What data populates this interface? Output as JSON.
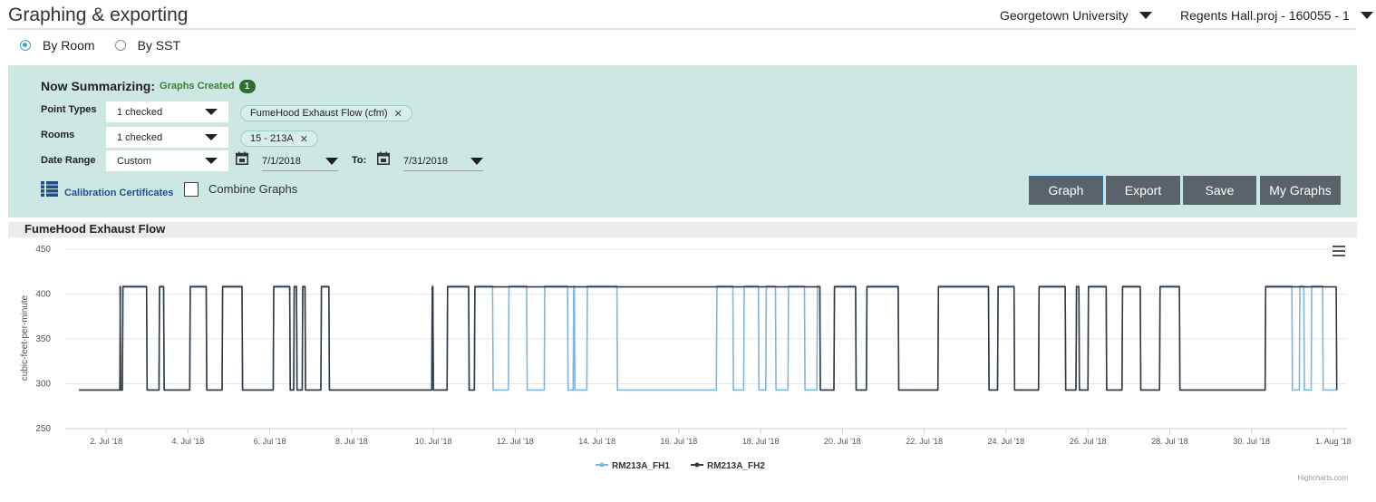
{
  "page_title": "Graphing & exporting",
  "top": {
    "org": "Georgetown University",
    "project": "Regents Hall.proj - 160055 - 1"
  },
  "radios": [
    {
      "label": "By Room",
      "selected": true
    },
    {
      "label": "By SST",
      "selected": false
    }
  ],
  "summary": {
    "heading": "Now Summarizing:",
    "graphs_created_label": "Graphs Created",
    "graphs_created_count": "1",
    "point_types": {
      "label": "Point Types",
      "value": "1 checked",
      "tag": "FumeHood Exhaust Flow (cfm)"
    },
    "rooms": {
      "label": "Rooms",
      "value": "1 checked",
      "tag": "15 - 213A"
    },
    "date_range": {
      "label": "Date Range",
      "value": "Custom",
      "from": "7/1/2018",
      "to_label": "To:",
      "to": "7/31/2018"
    },
    "calibration_link": "Calibration Certificates",
    "combine_label": "Combine Graphs",
    "combine_checked": false,
    "buttons": {
      "graph": "Graph",
      "export": "Export",
      "save": "Save",
      "my_graphs": "My Graphs"
    }
  },
  "graph_title": "FumeHood Exhaust Flow",
  "credits": "Highcharts.com",
  "colors": {
    "panel": "#cde7e2",
    "fh1": "#7eb6dd",
    "fh2": "#333a44",
    "button": "#5a636a"
  },
  "chart_data": {
    "type": "line",
    "ylabel": "cubic-feet-per-minute",
    "ylim": [
      250,
      450
    ],
    "yticks": [
      "450",
      "400",
      "350",
      "300",
      "250"
    ],
    "xlabel": "",
    "x_domain": [
      "2018-07-01",
      "2018-08-01T08:00"
    ],
    "xticks": [
      {
        "label": "2. Jul '18",
        "day": 2
      },
      {
        "label": "4. Jul '18",
        "day": 4
      },
      {
        "label": "6. Jul '18",
        "day": 6
      },
      {
        "label": "8. Jul '18",
        "day": 8
      },
      {
        "label": "10. Jul '18",
        "day": 10
      },
      {
        "label": "12. Jul '18",
        "day": 12
      },
      {
        "label": "14. Jul '18",
        "day": 14
      },
      {
        "label": "16. Jul '18",
        "day": 16
      },
      {
        "label": "18. Jul '18",
        "day": 18
      },
      {
        "label": "20. Jul '18",
        "day": 20
      },
      {
        "label": "22. Jul '18",
        "day": 22
      },
      {
        "label": "24. Jul '18",
        "day": 24
      },
      {
        "label": "26. Jul '18",
        "day": 26
      },
      {
        "label": "28. Jul '18",
        "day": 28
      },
      {
        "label": "30. Jul '18",
        "day": 30
      },
      {
        "label": "1. Aug '18",
        "day": 32
      }
    ],
    "grid": true,
    "legend_position": "bottom-center",
    "series": [
      {
        "name": "RM213A_FH1",
        "low": 293,
        "high": 409,
        "start": "2018-07-01T08:00",
        "end": "2018-08-01T02:00",
        "high_intervals": [
          [
            "2018-07-02T08:00",
            "2018-07-02T08:30"
          ],
          [
            "2018-07-02T09:30",
            "2018-07-03T00:00"
          ],
          [
            "2018-07-03T07:00",
            "2018-07-03T10:00"
          ],
          [
            "2018-07-04T01:00",
            "2018-07-04T11:00"
          ],
          [
            "2018-07-04T20:00",
            "2018-07-05T08:00"
          ],
          [
            "2018-07-06T02:00",
            "2018-07-06T12:00"
          ],
          [
            "2018-07-06T14:00",
            "2018-07-06T16:00"
          ],
          [
            "2018-07-06T19:00",
            "2018-07-06T21:00"
          ],
          [
            "2018-07-07T06:00",
            "2018-07-07T11:00"
          ],
          [
            "2018-07-09T23:00",
            "2018-07-10T00:00"
          ],
          [
            "2018-07-10T08:00",
            "2018-07-10T21:00"
          ],
          [
            "2018-07-11T00:00",
            "2018-07-11T11:00"
          ],
          [
            "2018-07-11T20:00",
            "2018-07-12T07:00"
          ],
          [
            "2018-07-12T17:00",
            "2018-07-13T07:00"
          ],
          [
            "2018-07-13T10:00",
            "2018-07-13T11:00"
          ],
          [
            "2018-07-13T18:00",
            "2018-07-14T12:00"
          ],
          [
            "2018-07-16T22:00",
            "2018-07-17T08:00"
          ],
          [
            "2018-07-17T14:00",
            "2018-07-17T23:00"
          ],
          [
            "2018-07-18T03:00",
            "2018-07-18T09:00"
          ],
          [
            "2018-07-18T16:00",
            "2018-07-19T02:00"
          ],
          [
            "2018-07-19T09:00",
            "2018-07-19T11:00"
          ],
          [
            "2018-07-19T19:00",
            "2018-07-20T08:00"
          ],
          [
            "2018-07-20T14:00",
            "2018-07-21T09:00"
          ],
          [
            "2018-07-22T08:00",
            "2018-07-23T14:00"
          ],
          [
            "2018-07-23T19:00",
            "2018-07-24T05:00"
          ],
          [
            "2018-07-24T19:00",
            "2018-07-25T11:00"
          ],
          [
            "2018-07-25T17:00",
            "2018-07-25T19:00"
          ],
          [
            "2018-07-26T00:00",
            "2018-07-26T11:00"
          ],
          [
            "2018-07-26T20:00",
            "2018-07-27T07:00"
          ],
          [
            "2018-07-27T18:00",
            "2018-07-28T06:00"
          ],
          [
            "2018-07-30T08:00",
            "2018-07-31T00:00"
          ],
          [
            "2018-07-31T04:00",
            "2018-07-31T07:00"
          ],
          [
            "2018-07-31T11:00",
            "2018-07-31T18:00"
          ]
        ]
      },
      {
        "name": "RM213A_FH2",
        "low": 293,
        "high": 408,
        "start": "2018-07-01T08:00",
        "end": "2018-08-01T02:00",
        "high_intervals": [
          [
            "2018-07-02T08:00",
            "2018-07-02T08:30"
          ],
          [
            "2018-07-02T09:30",
            "2018-07-03T00:00"
          ],
          [
            "2018-07-03T07:00",
            "2018-07-03T10:00"
          ],
          [
            "2018-07-04T01:00",
            "2018-07-04T11:00"
          ],
          [
            "2018-07-04T20:00",
            "2018-07-05T08:00"
          ],
          [
            "2018-07-06T02:00",
            "2018-07-06T12:00"
          ],
          [
            "2018-07-06T14:00",
            "2018-07-06T16:00"
          ],
          [
            "2018-07-06T19:00",
            "2018-07-06T21:00"
          ],
          [
            "2018-07-07T06:00",
            "2018-07-07T11:00"
          ],
          [
            "2018-07-09T23:00",
            "2018-07-10T00:00"
          ],
          [
            "2018-07-10T08:00",
            "2018-07-10T21:00"
          ],
          [
            "2018-07-11T00:00",
            "2018-07-19T11:00"
          ],
          [
            "2018-07-19T19:00",
            "2018-07-20T08:00"
          ],
          [
            "2018-07-20T14:00",
            "2018-07-21T09:00"
          ],
          [
            "2018-07-22T08:00",
            "2018-07-23T14:00"
          ],
          [
            "2018-07-23T19:00",
            "2018-07-24T05:00"
          ],
          [
            "2018-07-24T19:00",
            "2018-07-25T11:00"
          ],
          [
            "2018-07-25T17:00",
            "2018-07-25T19:00"
          ],
          [
            "2018-07-26T00:00",
            "2018-07-26T11:00"
          ],
          [
            "2018-07-26T20:00",
            "2018-07-27T07:00"
          ],
          [
            "2018-07-27T18:00",
            "2018-07-28T06:00"
          ],
          [
            "2018-07-30T08:00",
            "2018-08-01T02:00"
          ]
        ]
      }
    ]
  }
}
